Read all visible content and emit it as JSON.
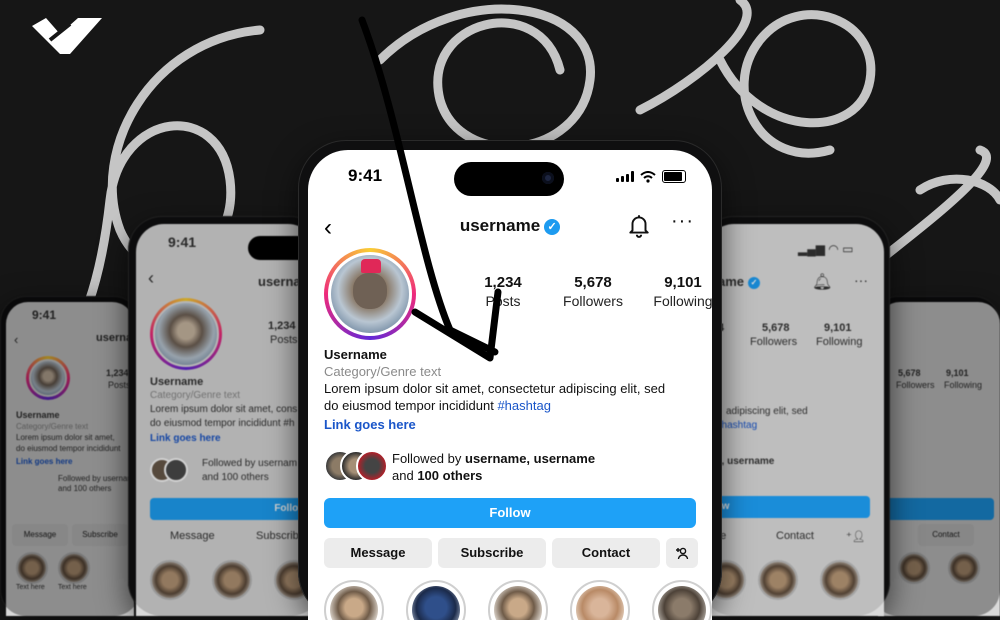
{
  "status": {
    "time": "9:41"
  },
  "profile": {
    "username": "username",
    "verified_mark": "✓",
    "stats": [
      {
        "num": "1,234",
        "label": "Posts"
      },
      {
        "num": "5,678",
        "label": "Followers"
      },
      {
        "num": "9,101",
        "label": "Following"
      }
    ],
    "name": "Username",
    "category": "Category/Genre text",
    "bio_line1": "Lorem ipsum dolor sit amet, consectetur adipiscing elit, sed",
    "bio_line2": "do eiusmod tempor incididunt",
    "hashtag": "#hashtag",
    "link": "Link goes here",
    "followed_by_prefix": "Followed by",
    "followed_by_names": "username, username",
    "followed_by_and": "and",
    "followed_by_others": "100 others"
  },
  "buttons": {
    "follow": "Follow",
    "message": "Message",
    "subscribe": "Subscribe",
    "contact": "Contact"
  },
  "side_phones": {
    "left_name": "Username",
    "left_category": "Category/Genre text",
    "left_bio": "Lorem ipsum dolor sit amet, cons",
    "left_bio2": "do eiusmod tempor incididunt #h",
    "left_link": "Link goes here",
    "left_followed": "Followed by usernam",
    "left_followed2": "and 100 others",
    "left_follow": "Follow",
    "left_message": "Message",
    "left_subscribe": "Subscrib",
    "left_posts_num": "1,234",
    "left_posts_lbl": "Posts",
    "left_header": "userna",
    "left_time": "9:41",
    "far_left_time": "9:41",
    "far_left_header": "username",
    "far_left_stat": "1,234",
    "far_left_stat_lbl": "Posts",
    "far_left_name": "Username",
    "far_left_category": "Category/Genre text",
    "far_left_bio": "Lorem ipsum dolor sit amet,",
    "far_left_bio2": "do eiusmod tempor incididunt",
    "far_left_link": "Link goes here",
    "far_left_followed": "Followed by username",
    "far_left_followed2": "and 100 others",
    "far_left_message": "Message",
    "far_left_subscribe": "Subscribe",
    "far_left_hl": "Text here",
    "right_header": "ame",
    "right_stats": [
      {
        "num": "5,678",
        "label": "Followers"
      },
      {
        "num": "9,101",
        "label": "Following"
      }
    ],
    "right_bio": "adipiscing elit, sed",
    "right_hashtag": "#hashtag",
    "right_followed": "e, username",
    "right_follow": "llow",
    "right_contact": "Contact",
    "right_act_left": "be",
    "far_right_stats": [
      {
        "num": "5,678",
        "label": "Followers"
      },
      {
        "num": "9,101",
        "label": "Following"
      }
    ],
    "far_right_contact": "Contact"
  },
  "colors": {
    "accent": "#1ea1f7",
    "link": "#1a56c9",
    "background": "#1a1a1a"
  }
}
